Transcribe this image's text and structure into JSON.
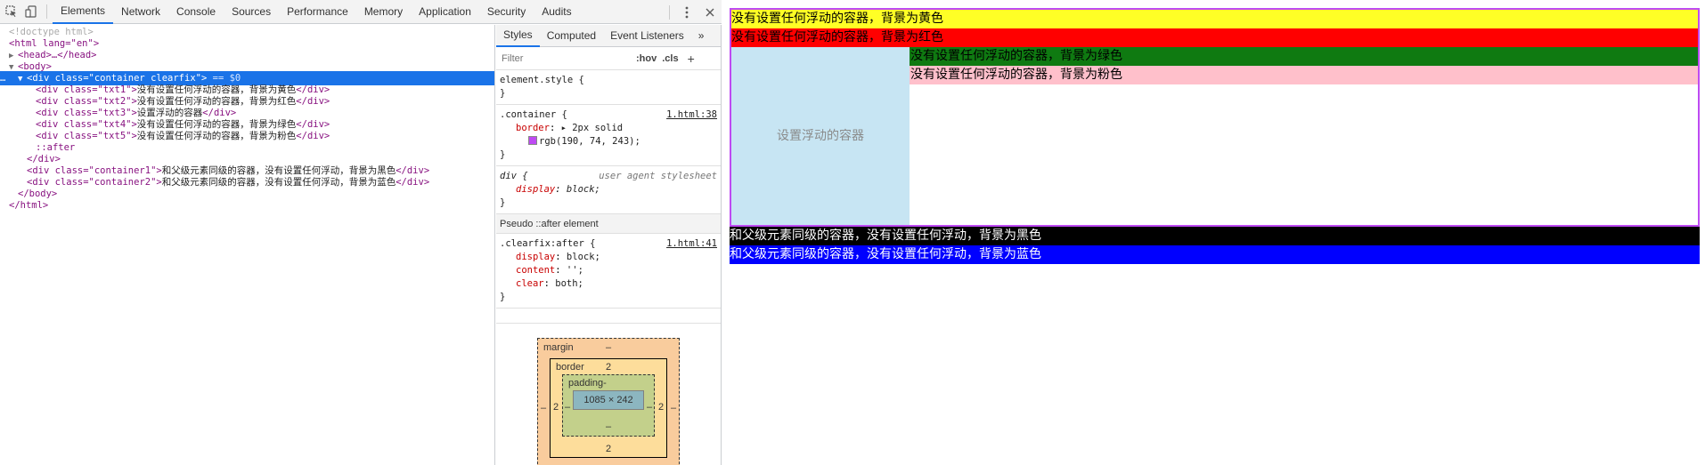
{
  "toolbar": {
    "tabs": [
      "Elements",
      "Network",
      "Console",
      "Sources",
      "Performance",
      "Memory",
      "Application",
      "Security",
      "Audits"
    ],
    "active_tab": "Elements",
    "icons": [
      "inspect-icon",
      "device-toggle-icon",
      "more-vert-icon",
      "close-icon"
    ]
  },
  "elements_tree": {
    "doctype": "<!doctype html>",
    "html_open": "<html lang=\"en\">",
    "head": "<head>…</head>",
    "body_open": "<body>",
    "container_open": "<div class=\"container clearfix\">",
    "container_marker": " == $0",
    "children": [
      {
        "open": "<div class=\"txt1\">",
        "text": "没有设置任何浮动的容器，背景为黄色",
        "close": "</div>"
      },
      {
        "open": "<div class=\"txt2\">",
        "text": "没有设置任何浮动的容器，背景为红色",
        "close": "</div>"
      },
      {
        "open": "<div class=\"txt3\">",
        "text": "设置浮动的容器",
        "close": "</div>"
      },
      {
        "open": "<div class=\"txt4\">",
        "text": "没有设置任何浮动的容器，背景为绿色",
        "close": "</div>"
      },
      {
        "open": "<div class=\"txt5\">",
        "text": "没有设置任何浮动的容器，背景为粉色",
        "close": "</div>"
      }
    ],
    "after": "::after",
    "container_close": "</div>",
    "container1": {
      "open": "<div class=\"container1\">",
      "text": "和父级元素同级的容器，没有设置任何浮动，背景为黑色",
      "close": "</div>"
    },
    "container2": {
      "open": "<div class=\"container2\">",
      "text": "和父级元素同级的容器，没有设置任何浮动，背景为蓝色",
      "close": "</div>"
    },
    "body_close": "</body>",
    "html_close": "</html>"
  },
  "styles_pane": {
    "tabs": [
      "Styles",
      "Computed",
      "Event Listeners"
    ],
    "active_tab": "Styles",
    "more": "»",
    "filter_placeholder": "Filter",
    "hov": ":hov",
    "cls": ".cls",
    "add": "+",
    "rules": {
      "element_style": {
        "selector": "element.style {",
        "close": "}"
      },
      "container": {
        "selector": ".container {",
        "source": "1.html:38",
        "prop": "border",
        "value_line1": "▸ 2px solid",
        "value_line2": "rgb(190, 74, 243);",
        "swatch": "#be4af3",
        "close": "}"
      },
      "div_ua": {
        "selector": "div {",
        "source": "user agent stylesheet",
        "prop": "display",
        "value": "block;",
        "close": "}"
      }
    },
    "pseudo_header": "Pseudo ::after element",
    "clearfix": {
      "selector": ".clearfix:after {",
      "source": "1.html:41",
      "props": [
        {
          "name": "display",
          "value": "block;"
        },
        {
          "name": "content",
          "value": "'';"
        },
        {
          "name": "clear",
          "value": "both;"
        }
      ],
      "close": "}"
    },
    "box_model": {
      "margin_label": "margin",
      "margin_top": "–",
      "margin_bottom": "–",
      "margin_left": "–",
      "margin_right": "–",
      "border_label": "border",
      "border_top": "2",
      "border_bottom": "2",
      "border_left": "2",
      "border_right": "2",
      "padding_label": "padding-",
      "padding_bottom": "–",
      "padding_left": "–",
      "padding_right": "–",
      "content": "1085 × 242"
    }
  },
  "page": {
    "txt1": "没有设置任何浮动的容器，背景为黄色",
    "txt2": "没有设置任何浮动的容器，背景为红色",
    "txt3": "设置浮动的容器",
    "txt4": "没有设置任何浮动的容器，背景为绿色",
    "txt5": "没有设置任何浮动的容器，背景为粉色",
    "container1": "和父级元素同级的容器，没有设置任何浮动，背景为黑色",
    "container2": "和父级元素同级的容器，没有设置任何浮动，背景为蓝色",
    "colors": {
      "border": "#be4af3",
      "yellow": "#ffff26",
      "red": "#ff0000",
      "float_bg": "#c7e5f3",
      "green": "#0f7a11",
      "pink": "#ffc0cb",
      "black": "#000000",
      "blue": "#0000ff",
      "selection": "#1a73e8"
    }
  }
}
